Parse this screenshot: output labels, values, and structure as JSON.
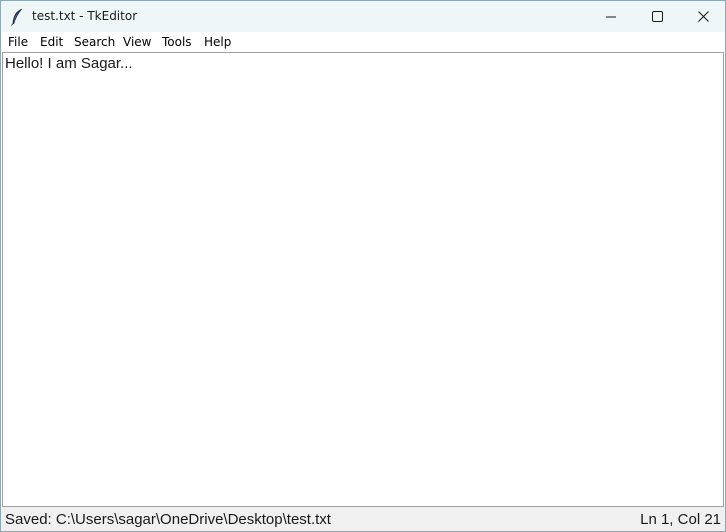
{
  "window": {
    "title": "test.txt - TkEditor",
    "app_icon": "feather-quill-icon"
  },
  "window_controls": {
    "minimize_icon": "minimize-icon",
    "maximize_icon": "maximize-icon",
    "close_icon": "close-icon"
  },
  "menubar": {
    "items": [
      {
        "label": "File"
      },
      {
        "label": "Edit"
      },
      {
        "label": "Search"
      },
      {
        "label": "View"
      },
      {
        "label": "Tools"
      },
      {
        "label": "Help"
      }
    ]
  },
  "editor": {
    "content": "Hello! I am Sagar..."
  },
  "statusbar": {
    "message": "Saved: C:\\Users\\sagar\\OneDrive\\Desktop\\test.txt",
    "cursor_position": "Ln 1, Col 21"
  },
  "colors": {
    "titlebar_bg": "#eef6f7",
    "statusbar_bg": "#f0f0f0",
    "editor_bg": "#ffffff"
  }
}
